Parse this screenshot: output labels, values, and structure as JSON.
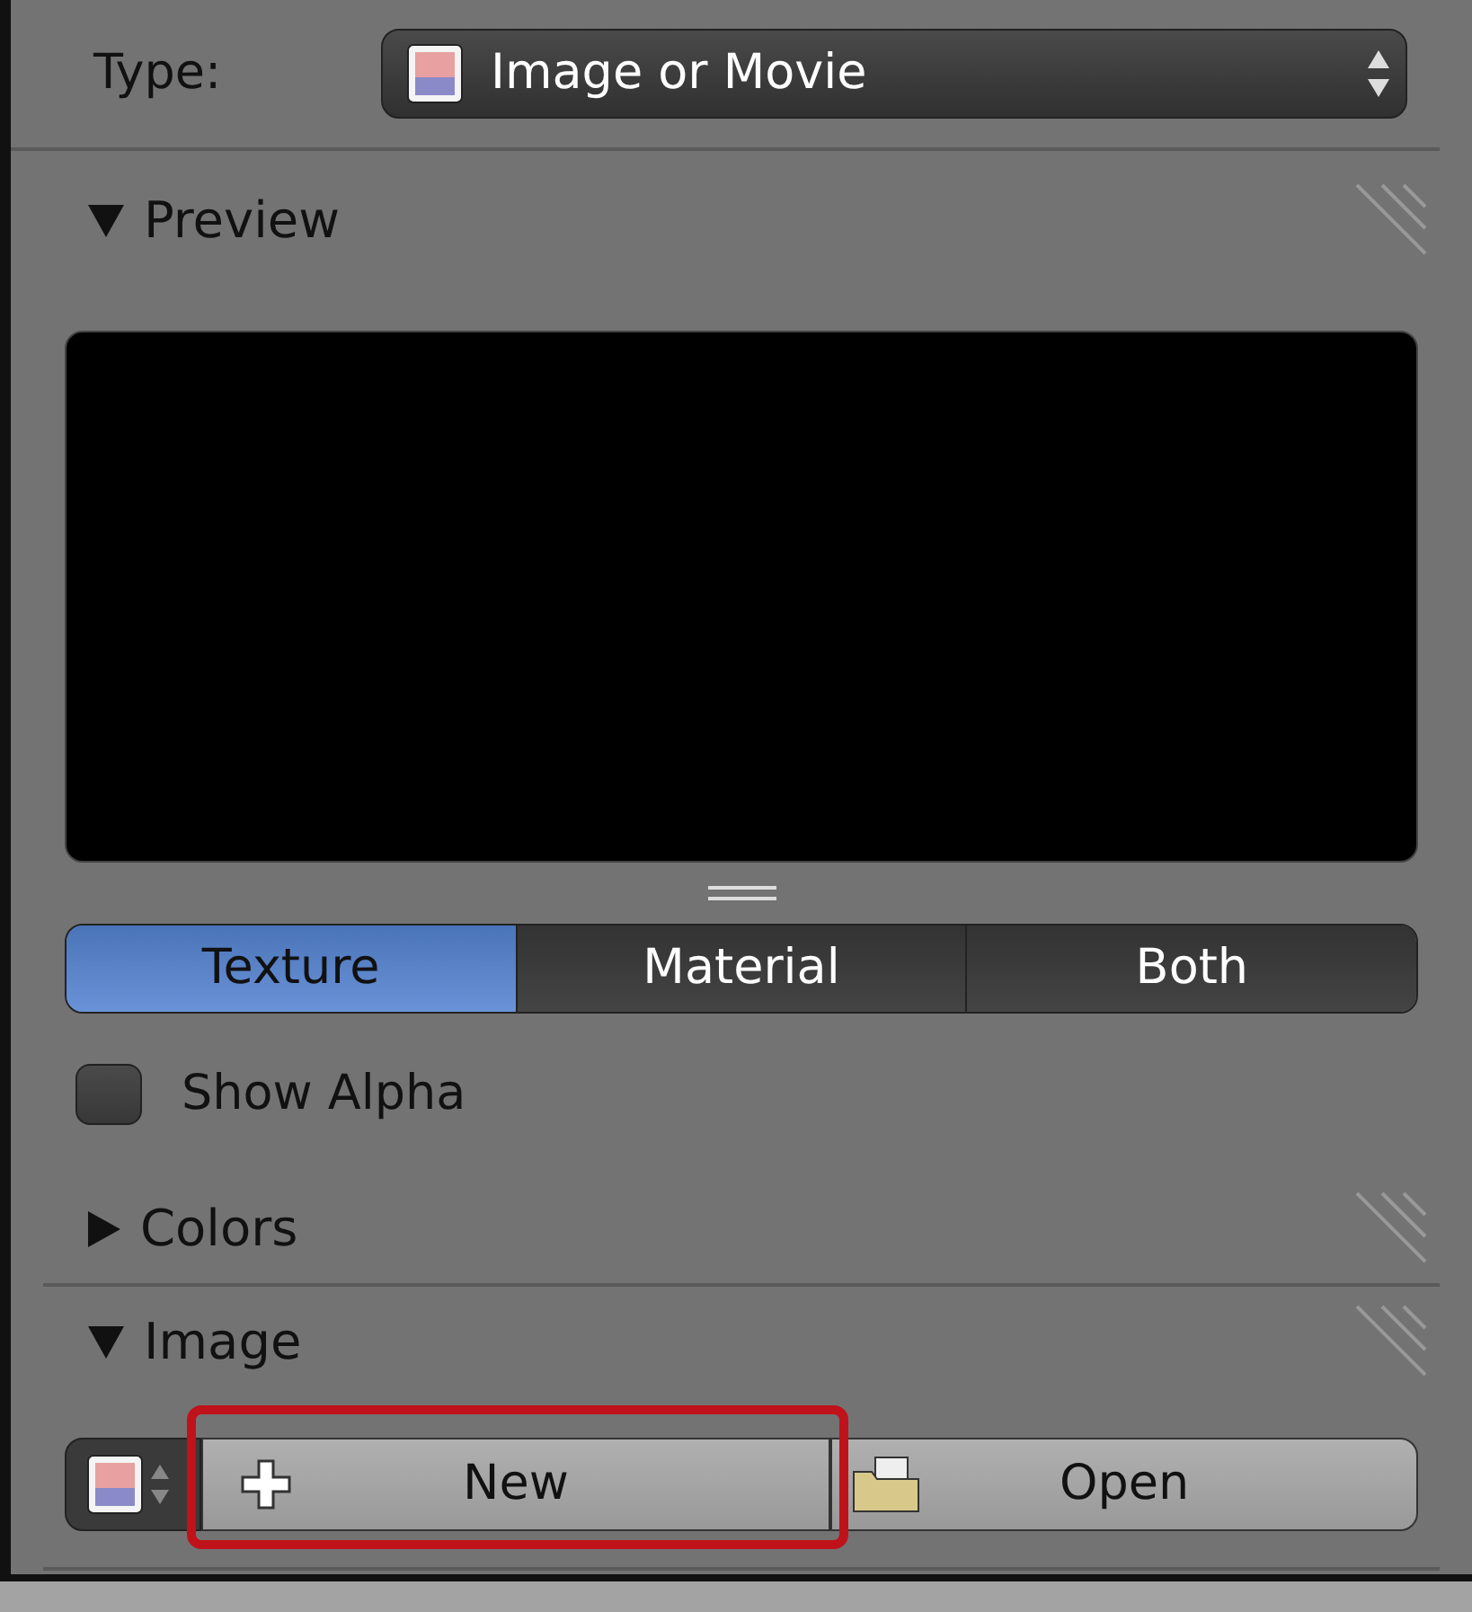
{
  "type_field": {
    "label": "Type:",
    "value": "Image or Movie"
  },
  "preview": {
    "title": "Preview",
    "expanded": true,
    "view_buttons": [
      {
        "label": "Texture",
        "selected": true
      },
      {
        "label": "Material",
        "selected": false
      },
      {
        "label": "Both",
        "selected": false
      }
    ],
    "show_alpha": {
      "label": "Show Alpha",
      "checked": false
    }
  },
  "colors": {
    "title": "Colors",
    "expanded": false
  },
  "image": {
    "title": "Image",
    "expanded": true,
    "new_button": "New",
    "open_button": "Open"
  }
}
